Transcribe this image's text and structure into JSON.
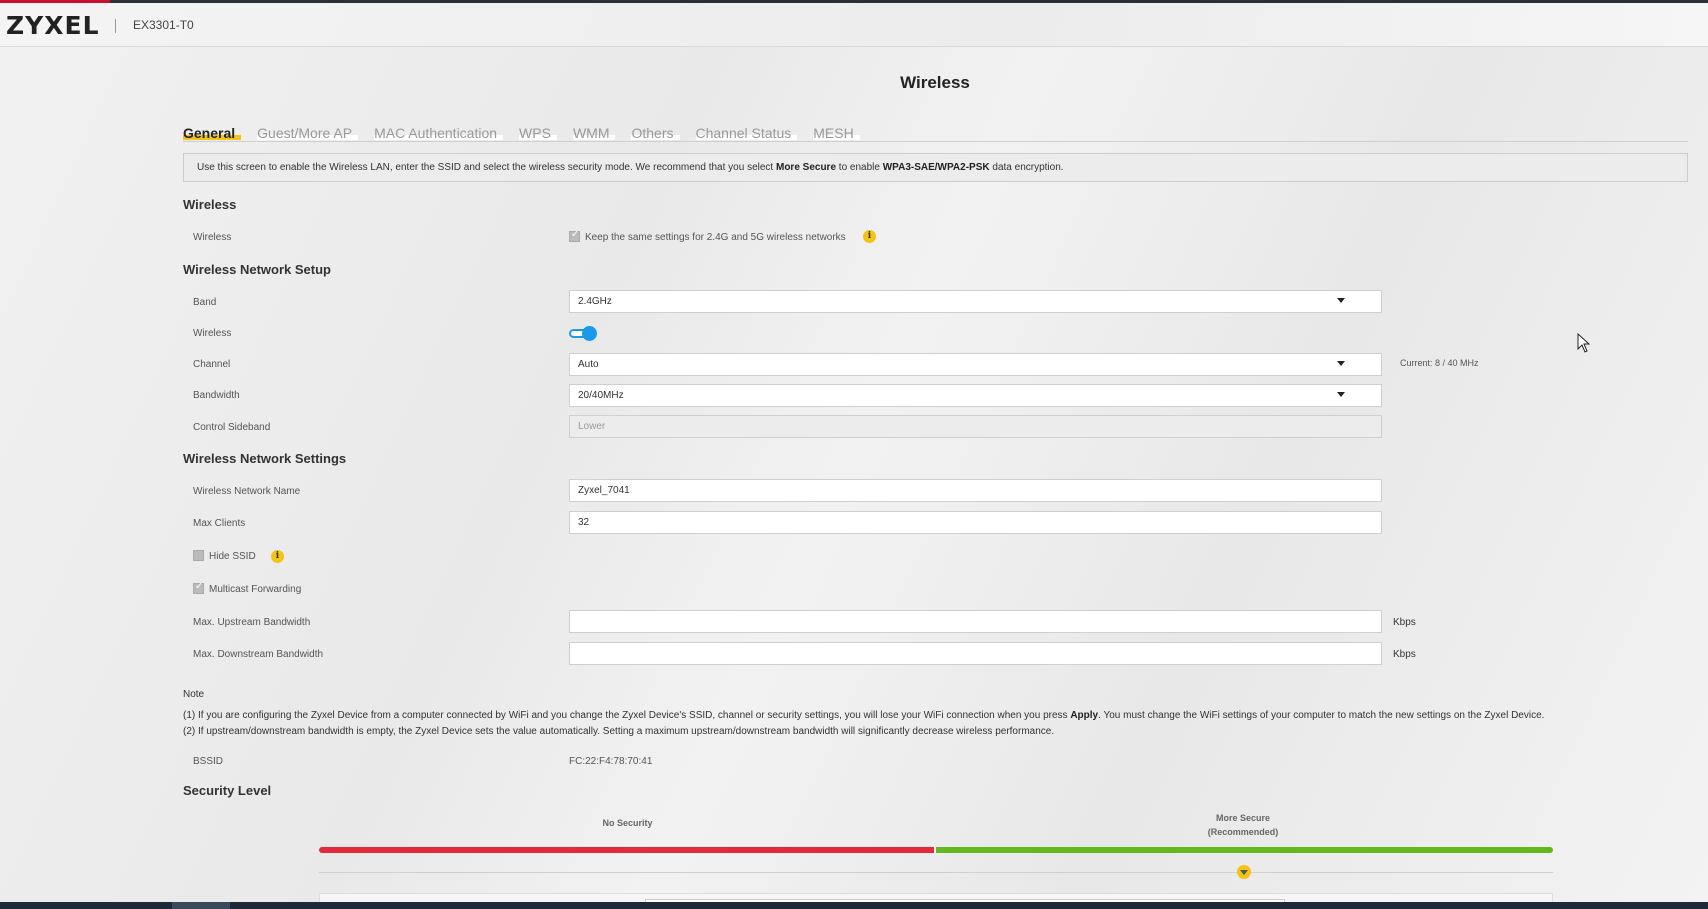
{
  "header": {
    "logo": "ZYXEL",
    "model": "EX3301-T0"
  },
  "page": {
    "title": "Wireless"
  },
  "tabs": [
    {
      "label": "General",
      "active": true
    },
    {
      "label": "Guest/More AP",
      "active": false
    },
    {
      "label": "MAC Authentication",
      "active": false
    },
    {
      "label": "WPS",
      "active": false
    },
    {
      "label": "WMM",
      "active": false
    },
    {
      "label": "Others",
      "active": false
    },
    {
      "label": "Channel Status",
      "active": false
    },
    {
      "label": "MESH",
      "active": false
    }
  ],
  "info": {
    "pre": "Use this screen to enable the Wireless LAN, enter the SSID and select the wireless security mode. We recommend that you select ",
    "bold1": "More Secure",
    "mid": " to enable ",
    "bold2": "WPA3-SAE/WPA2-PSK",
    "post": " data encryption."
  },
  "wireless_section": {
    "title": "Wireless",
    "label": "Wireless",
    "keep_same_label": "Keep the same settings for 2.4G and 5G wireless networks",
    "keep_same_checked": true
  },
  "setup_section": {
    "title": "Wireless Network Setup",
    "band_label": "Band",
    "band_value": "2.4GHz",
    "wireless_label": "Wireless",
    "wireless_on": true,
    "channel_label": "Channel",
    "channel_value": "Auto",
    "channel_current": "Current: 8 / 40 MHz",
    "bandwidth_label": "Bandwidth",
    "bandwidth_value": "20/40MHz",
    "sideband_label": "Control Sideband",
    "sideband_value": "Lower"
  },
  "settings_section": {
    "title": "Wireless Network Settings",
    "name_label": "Wireless Network Name",
    "name_value": "Zyxel_7041",
    "max_clients_label": "Max Clients",
    "max_clients_value": "32",
    "hide_ssid_label": "Hide SSID",
    "hide_ssid_checked": false,
    "multicast_label": "Multicast Forwarding",
    "multicast_checked": true,
    "upstream_label": "Max. Upstream Bandwidth",
    "upstream_value": "",
    "downstream_label": "Max. Downstream Bandwidth",
    "downstream_value": "",
    "unit": "Kbps"
  },
  "notes": {
    "title": "Note",
    "line1_pre": "(1) If you are configuring the Zyxel Device from a computer connected by WiFi and you change the Zyxel Device's SSID, channel or security settings, you will lose your WiFi connection when you press ",
    "line1_bold": "Apply",
    "line1_post": ". You must change the WiFi settings of your computer to match the new settings on the Zyxel Device.",
    "line2": "(2) If upstream/downstream bandwidth is empty, the Zyxel Device sets the value automatically. Setting a maximum upstream/downstream bandwidth will significantly decrease wireless performance."
  },
  "bssid": {
    "label": "BSSID",
    "value": "FC:22:F4:78:70:41"
  },
  "security": {
    "title": "Security Level",
    "no_security": "No Security",
    "more_secure_line1": "More Secure",
    "more_secure_line2": "(Recommended)",
    "colors": {
      "low": "#e32a3a",
      "high": "#62b81e",
      "accent": "#f3c414"
    }
  }
}
